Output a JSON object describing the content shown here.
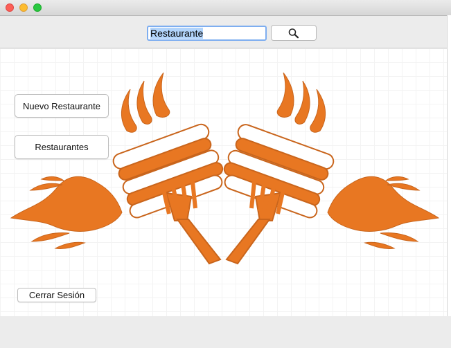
{
  "window": {
    "title": ""
  },
  "search": {
    "value": "Restaurante",
    "button_icon": "magnifier-icon"
  },
  "sidebar": {
    "new_restaurant_label": "Nuevo Restaurante",
    "restaurants_label": "Restaurantes",
    "logout_label": "Cerrar Sesión"
  },
  "logo": {
    "accent": "#e87722",
    "description_icon": "torch-forks-logo"
  }
}
